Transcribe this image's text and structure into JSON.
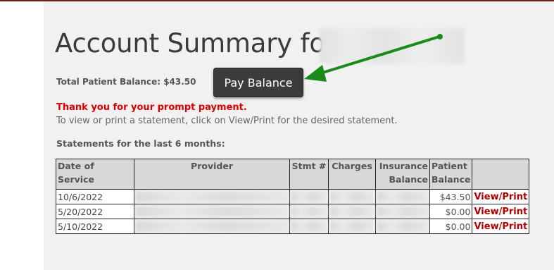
{
  "header": {
    "title": "Account Summary for"
  },
  "balance": {
    "label": "Total Patient Balance: $43.50",
    "pay_button_label": "Pay Balance"
  },
  "messages": {
    "thanks": "Thank you for your prompt payment.",
    "instructions": "To view or print a statement, click on View/Print for the desired statement."
  },
  "statements": {
    "heading": "Statements for the last 6 months:",
    "columns": {
      "date": "Date of Service",
      "provider": "Provider",
      "stmt": "Stmt #",
      "charges": "Charges",
      "insurance": "Insurance Balance",
      "patient": "Patient Balance"
    },
    "rows": [
      {
        "date": "10/6/2022",
        "patient_balance": "$43.50",
        "link": "View/Print"
      },
      {
        "date": "5/20/2022",
        "patient_balance": "$0.00",
        "link": "View/Print"
      },
      {
        "date": "5/10/2022",
        "patient_balance": "$0.00",
        "link": "View/Print"
      }
    ]
  },
  "colors": {
    "accent_red": "#dd0000",
    "link_red": "#b40000",
    "arrow_green": "#1a8a1a",
    "button_bg": "#3b3b3b"
  }
}
